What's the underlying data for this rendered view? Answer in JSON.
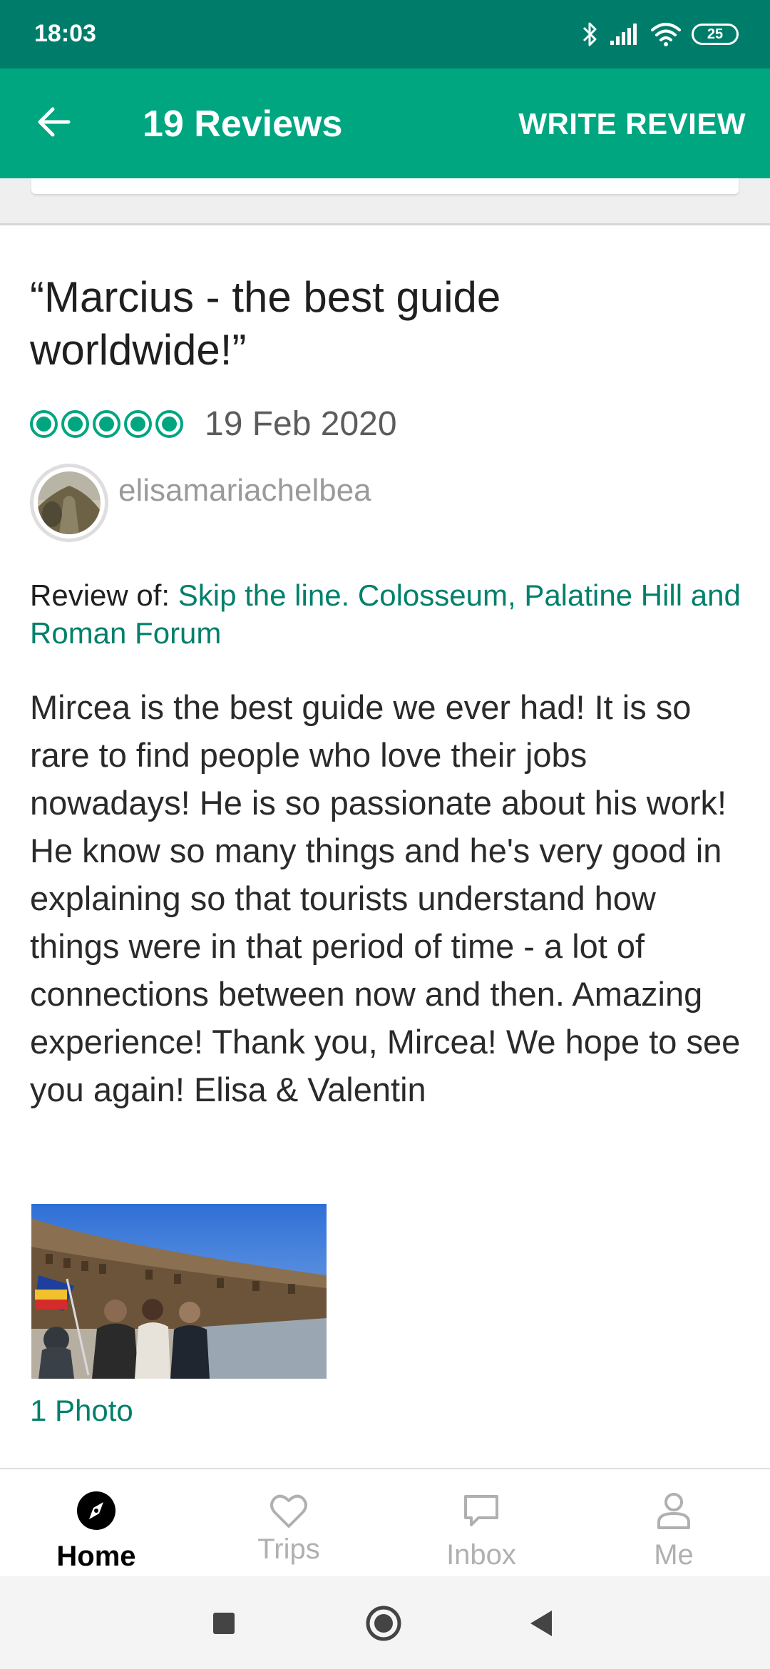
{
  "status_bar": {
    "time": "18:03",
    "battery": "25",
    "icons": [
      "bluetooth-icon",
      "signal-icon",
      "wifi-icon",
      "battery-icon"
    ]
  },
  "app_bar": {
    "title": "19 Reviews",
    "action": "WRITE REVIEW",
    "back_icon": "arrow-left-icon"
  },
  "review": {
    "title": "“Marcius - the best guide worldwide!”",
    "rating": 5,
    "rating_max": 5,
    "date": "19 Feb 2020",
    "username": "elisamariachelbea",
    "review_of_label": "Review of:",
    "review_of_link": "Skip the line. Colosseum, Palatine Hill and Roman Forum",
    "body": "Mircea is the best guide we ever had! It is so rare to find people who love their jobs nowadays! He is so passionate about his work! He know so many things and he's very good in explaining so that tourists understand how things were in that period of time - a lot of connections between now and then. Amazing experience! Thank you, Mircea! We hope to see you again! Elisa & Valentin",
    "photo_count": "1 Photo"
  },
  "bottom_nav": {
    "items": [
      {
        "label": "Home",
        "icon": "compass-icon",
        "active": true
      },
      {
        "label": "Trips",
        "icon": "heart-icon",
        "active": false
      },
      {
        "label": "Inbox",
        "icon": "message-icon",
        "active": false
      },
      {
        "label": "Me",
        "icon": "person-icon",
        "active": false
      }
    ]
  },
  "colors": {
    "status_bar": "#007d6a",
    "app_bar": "#00a680",
    "link": "#00806b",
    "rating": "#00a680"
  }
}
